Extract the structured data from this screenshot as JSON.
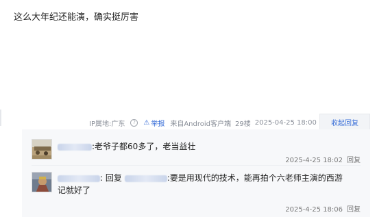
{
  "post": {
    "text": "这么大年纪还能演，确实挺厉害"
  },
  "meta": {
    "ip_location": "IP属地:广东",
    "help_icon": "?",
    "report_icon": "warning-icon",
    "report_label": "举报",
    "source": "来自Android客户端",
    "floor": "29楼",
    "datetime": "2025-04-25 18:00",
    "collapse_label": "收起回复"
  },
  "colors": {
    "accent": "#3a6fd8",
    "reply_bg": "#f7f8fa",
    "meta_text": "#8a8f99"
  },
  "replies": [
    {
      "content": ":老爷子都60多了，老当益壮",
      "time": "2025-4-25 18:02",
      "reply_label": "回复"
    },
    {
      "reply_prefix": ": 回复",
      "content_line1": ":要是用现代的技术，能再拍个六老师主演的西游",
      "content_line2": "记就好了",
      "time": "2025-4-25 18:06",
      "reply_label": "回复"
    }
  ]
}
